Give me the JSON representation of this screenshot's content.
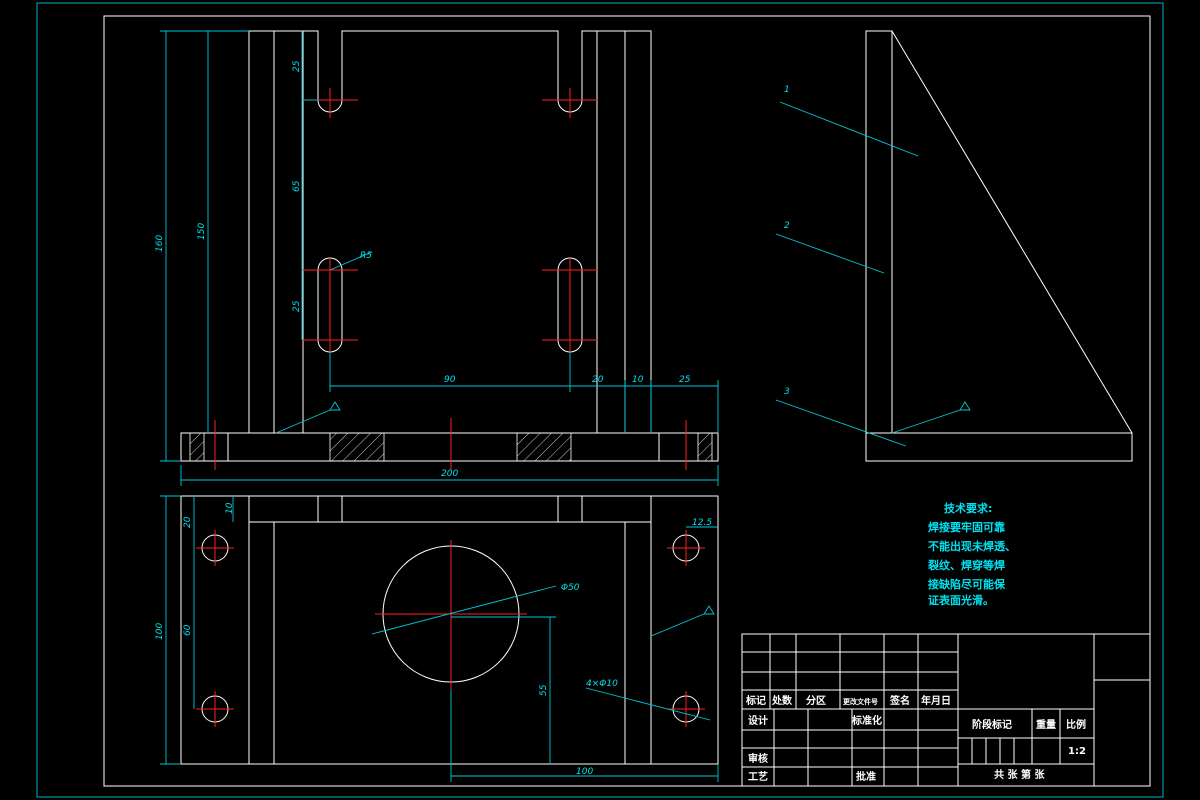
{
  "drawing": {
    "view_front": {
      "dims": {
        "h_160": "160",
        "h_150": "150",
        "v_25_top": "25",
        "v_65": "65",
        "v_25_mid": "25",
        "r5": "R5",
        "w_90": "90",
        "w_20": "20",
        "w_10": "10",
        "w_25": "25",
        "w_200": "200"
      }
    },
    "view_side": {
      "balloons": [
        "1",
        "2",
        "3"
      ]
    },
    "view_top": {
      "dims": {
        "d_10": "10",
        "d_20": "20",
        "d_12_5": "12.5",
        "d_100_v": "100",
        "d_60": "60",
        "phi50": "Φ50",
        "hole_4x": "4×Φ10",
        "d_55": "55",
        "d_100_h": "100"
      }
    },
    "tech_requirements": {
      "title": "技术要求:",
      "lines": [
        "焊接要牢固可靠",
        "不能出现未焊透、",
        "裂纹、焊穿等焊",
        "接缺陷尽可能保",
        "证表面光滑。"
      ]
    },
    "title_block": {
      "mark": "标记",
      "count": "处数",
      "zone": "分区",
      "change_doc": "更改文件号",
      "sign": "签名",
      "date": "年月日",
      "design": "设计",
      "standard": "标准化",
      "review": "审核",
      "process": "工艺",
      "approve": "批准",
      "stage_mark": "阶段标记",
      "weight": "重量",
      "scale_label": "比例",
      "scale_value": "1:2",
      "sheets": "共  张 第  张"
    },
    "colors": {
      "outline": "#ffffff",
      "dimension": "#00c8d8",
      "centerline": "#ff2020",
      "background": "#000000"
    }
  }
}
